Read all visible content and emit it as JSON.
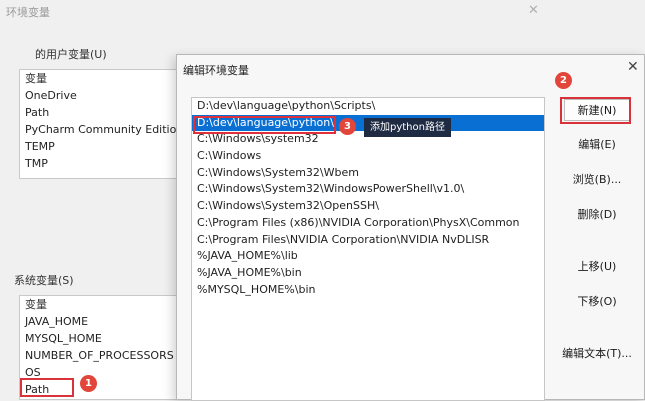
{
  "bg_window": {
    "title": "环境变量",
    "user_section_label": "的用户变量(U)",
    "user_vars": [
      "变量",
      "OneDrive",
      "Path",
      "PyCharm Community Edition",
      "TEMP",
      "TMP"
    ],
    "system_section_label": "系统变量(S)",
    "system_vars": [
      "变量",
      "JAVA_HOME",
      "MYSQL_HOME",
      "NUMBER_OF_PROCESSORS",
      "OS",
      "Path"
    ]
  },
  "dialog": {
    "title": "编辑环境变量",
    "paths": [
      "D:\\dev\\language\\python\\Scripts\\",
      "D:\\dev\\language\\python\\",
      "C:\\Windows\\system32",
      "C:\\Windows",
      "C:\\Windows\\System32\\Wbem",
      "C:\\Windows\\System32\\WindowsPowerShell\\v1.0\\",
      "C:\\Windows\\System32\\OpenSSH\\",
      "C:\\Program Files (x86)\\NVIDIA Corporation\\PhysX\\Common",
      "C:\\Program Files\\NVIDIA Corporation\\NVIDIA NvDLISR",
      "%JAVA_HOME%\\lib",
      "%JAVA_HOME%\\bin",
      "%MYSQL_HOME%\\bin"
    ],
    "selected_index": 1,
    "buttons": {
      "new": "新建(N)",
      "edit": "编辑(E)",
      "browse": "浏览(B)...",
      "delete": "删除(D)",
      "move_up": "上移(U)",
      "move_down": "下移(O)",
      "edit_text": "编辑文本(T)..."
    }
  },
  "annotations": {
    "step1": "1",
    "step2": "2",
    "step3": "3",
    "tooltip": "添加python路径",
    "highlight_color": "#d8333a"
  },
  "colors": {
    "selection": "#0a6fd3",
    "badge": "#e2453a",
    "tooltip_bg": "#1e2b43"
  }
}
